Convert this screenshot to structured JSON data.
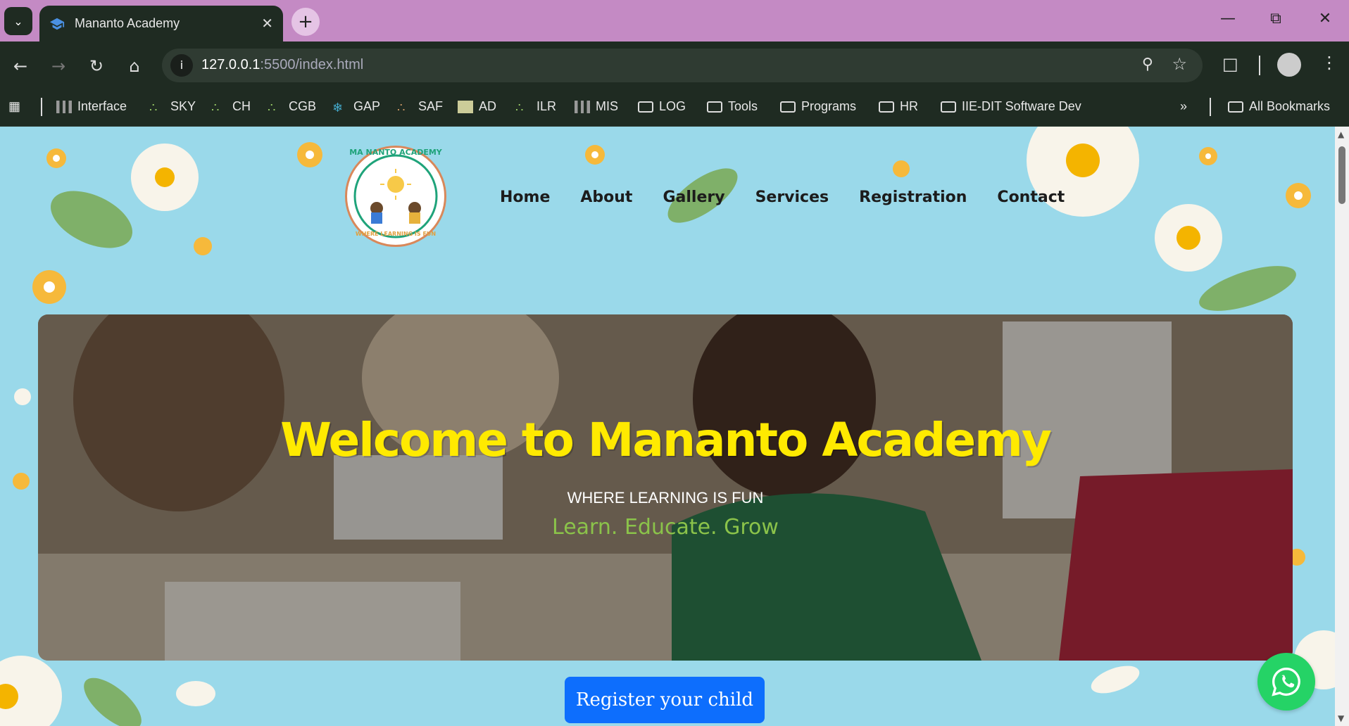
{
  "browser": {
    "tab_title": "Mananto Academy",
    "url_host": "127.0.0.1",
    "url_rest": ":5500/index.html",
    "bookmarks": [
      "Interface",
      "SKY",
      "CH",
      "CGB",
      "GAP",
      "SAF",
      "AD",
      "ILR",
      "MIS",
      "LOG",
      "Tools",
      "Programs",
      "HR",
      "IIE-DIT Software Dev"
    ],
    "all_bookmarks": "All Bookmarks"
  },
  "site": {
    "logo_top_text": "MA NANTO ACADEMY",
    "logo_bottom_text": "WHERE LEARNING IS FUN",
    "nav": [
      "Home",
      "About",
      "Gallery",
      "Services",
      "Registration",
      "Contact"
    ],
    "hero_title": "Welcome to Mananto Academy",
    "hero_subtitle": "WHERE LEARNING IS FUN",
    "hero_tagline": "Learn. Educate. Grow",
    "cta": "Register your child"
  },
  "colors": {
    "page_bg": "#9ad9ea",
    "title_yellow": "#ffea00",
    "tagline_green": "#8bc34a",
    "cta_blue": "#0d6efd",
    "whatsapp_green": "#25d366"
  }
}
